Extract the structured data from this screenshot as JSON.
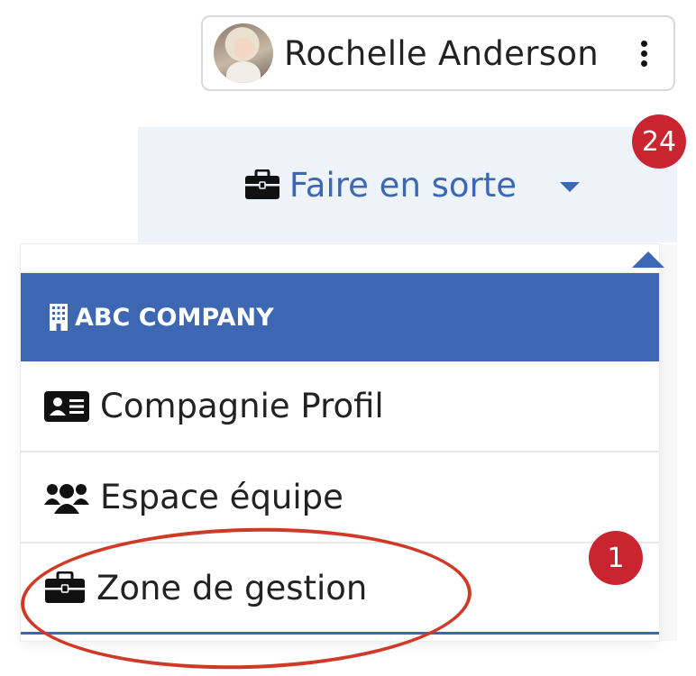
{
  "user": {
    "name": "Rochelle Anderson",
    "avatar_icon": "user-avatar-photo",
    "menu_icon": "kebab-menu-icon"
  },
  "tab": {
    "icon": "briefcase-icon",
    "label": "Faire en sorte",
    "caret_icon": "caret-down-icon",
    "notification_count": "24"
  },
  "dropdown": {
    "company": {
      "icon": "building-icon",
      "label": "ABC COMPANY"
    },
    "items": [
      {
        "icon": "id-card-icon",
        "label": "Compagnie Profil"
      },
      {
        "icon": "users-icon",
        "label": "Espace équipe"
      },
      {
        "icon": "briefcase-icon",
        "label": "Zone de gestion",
        "badge": "1"
      }
    ]
  },
  "colors": {
    "accent": "#3d67b3",
    "tab_bg": "#eef2f9",
    "badge": "#c9242f",
    "annotation": "#cf3a26"
  }
}
